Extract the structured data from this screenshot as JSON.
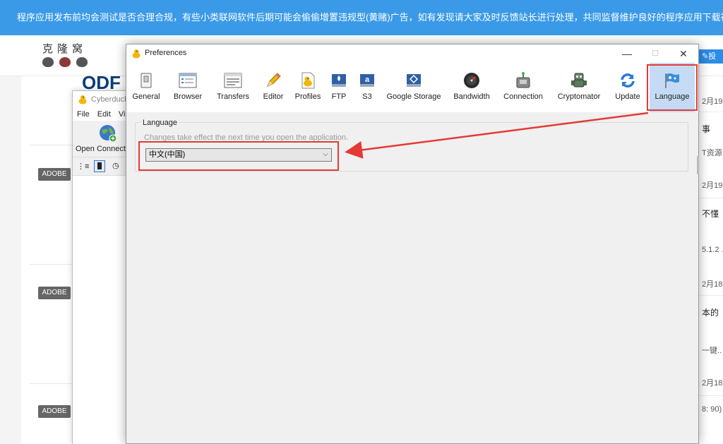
{
  "site": {
    "banner_text": "程序应用发布前均会测试是否合理合规，有些小类联网软件后期可能会偷偷增置违规型(黄赌)广告，如有发现请大家及时反馈站长进行处理，共同监督维护良好的程序应用下载社区！",
    "logo_text": "克隆窝",
    "post_button": "投",
    "od_logo": "ODF",
    "tags": [
      "ADOBE",
      "ADOBE",
      "ADOBE"
    ],
    "right_column": [
      "2月19",
      "事",
      "T资源",
      "2月19",
      "不懂",
      "5.1.2 ..",
      "2月18",
      "本的",
      "一键..",
      "2月18",
      "8: 90)"
    ]
  },
  "cyberduck": {
    "title": "Cyberduck",
    "menu": [
      "File",
      "Edit",
      "Vi"
    ],
    "open_connection_label": "Open Connection"
  },
  "preferences": {
    "title": "Preferences",
    "window_controls": {
      "minimize": "—",
      "maximize": "☐",
      "close": "✕"
    },
    "toolbar": [
      {
        "id": "general",
        "label": "General"
      },
      {
        "id": "browser",
        "label": "Browser"
      },
      {
        "id": "transfers",
        "label": "Transfers"
      },
      {
        "id": "editor",
        "label": "Editor"
      },
      {
        "id": "profiles",
        "label": "Profiles"
      },
      {
        "id": "ftp",
        "label": "FTP"
      },
      {
        "id": "s3",
        "label": "S3"
      },
      {
        "id": "google-storage",
        "label": "Google Storage"
      },
      {
        "id": "bandwidth",
        "label": "Bandwidth"
      },
      {
        "id": "connection",
        "label": "Connection"
      },
      {
        "id": "cryptomator",
        "label": "Cryptomator"
      },
      {
        "id": "update",
        "label": "Update"
      },
      {
        "id": "language",
        "label": "Language"
      }
    ],
    "selected_tab": "language",
    "language_group": {
      "title": "Language",
      "note": "Changes take effect the next time you open the application.",
      "selected_value": "中文(中国)"
    }
  },
  "colors": {
    "annotation": "#e53935",
    "banner": "#3a9ae8",
    "selected_tab": "#c5dbf5"
  }
}
